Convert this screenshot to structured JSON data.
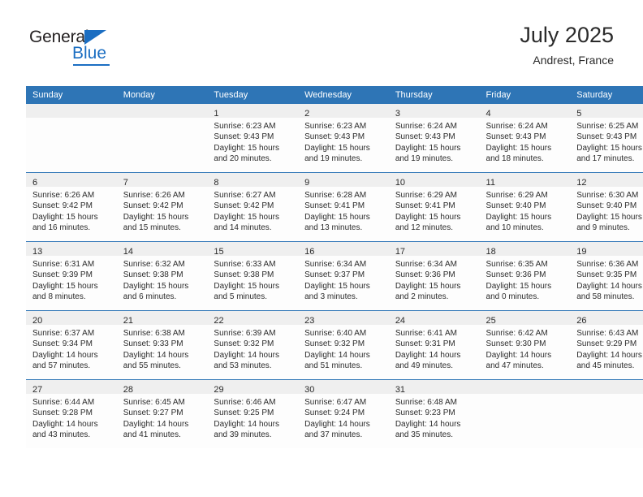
{
  "brand": {
    "name_top": "General",
    "name_bottom": "Blue",
    "accent_color": "#1b6ec2"
  },
  "header": {
    "title": "July 2025",
    "subtitle": "Andrest, France"
  },
  "theme": {
    "header_bar_color": "#2e75b6",
    "daynum_band_color": "#efefef",
    "separator_color": "#2e75b6",
    "text_color": "#2b2b2b"
  },
  "calendar": {
    "weekday_headers": [
      "Sunday",
      "Monday",
      "Tuesday",
      "Wednesday",
      "Thursday",
      "Friday",
      "Saturday"
    ],
    "weeks": [
      [
        {
          "day": "",
          "lines": []
        },
        {
          "day": "",
          "lines": []
        },
        {
          "day": "1",
          "lines": [
            "Sunrise: 6:23 AM",
            "Sunset: 9:43 PM",
            "Daylight: 15 hours",
            "and 20 minutes."
          ]
        },
        {
          "day": "2",
          "lines": [
            "Sunrise: 6:23 AM",
            "Sunset: 9:43 PM",
            "Daylight: 15 hours",
            "and 19 minutes."
          ]
        },
        {
          "day": "3",
          "lines": [
            "Sunrise: 6:24 AM",
            "Sunset: 9:43 PM",
            "Daylight: 15 hours",
            "and 19 minutes."
          ]
        },
        {
          "day": "4",
          "lines": [
            "Sunrise: 6:24 AM",
            "Sunset: 9:43 PM",
            "Daylight: 15 hours",
            "and 18 minutes."
          ]
        },
        {
          "day": "5",
          "lines": [
            "Sunrise: 6:25 AM",
            "Sunset: 9:43 PM",
            "Daylight: 15 hours",
            "and 17 minutes."
          ]
        }
      ],
      [
        {
          "day": "6",
          "lines": [
            "Sunrise: 6:26 AM",
            "Sunset: 9:42 PM",
            "Daylight: 15 hours",
            "and 16 minutes."
          ]
        },
        {
          "day": "7",
          "lines": [
            "Sunrise: 6:26 AM",
            "Sunset: 9:42 PM",
            "Daylight: 15 hours",
            "and 15 minutes."
          ]
        },
        {
          "day": "8",
          "lines": [
            "Sunrise: 6:27 AM",
            "Sunset: 9:42 PM",
            "Daylight: 15 hours",
            "and 14 minutes."
          ]
        },
        {
          "day": "9",
          "lines": [
            "Sunrise: 6:28 AM",
            "Sunset: 9:41 PM",
            "Daylight: 15 hours",
            "and 13 minutes."
          ]
        },
        {
          "day": "10",
          "lines": [
            "Sunrise: 6:29 AM",
            "Sunset: 9:41 PM",
            "Daylight: 15 hours",
            "and 12 minutes."
          ]
        },
        {
          "day": "11",
          "lines": [
            "Sunrise: 6:29 AM",
            "Sunset: 9:40 PM",
            "Daylight: 15 hours",
            "and 10 minutes."
          ]
        },
        {
          "day": "12",
          "lines": [
            "Sunrise: 6:30 AM",
            "Sunset: 9:40 PM",
            "Daylight: 15 hours",
            "and 9 minutes."
          ]
        }
      ],
      [
        {
          "day": "13",
          "lines": [
            "Sunrise: 6:31 AM",
            "Sunset: 9:39 PM",
            "Daylight: 15 hours",
            "and 8 minutes."
          ]
        },
        {
          "day": "14",
          "lines": [
            "Sunrise: 6:32 AM",
            "Sunset: 9:38 PM",
            "Daylight: 15 hours",
            "and 6 minutes."
          ]
        },
        {
          "day": "15",
          "lines": [
            "Sunrise: 6:33 AM",
            "Sunset: 9:38 PM",
            "Daylight: 15 hours",
            "and 5 minutes."
          ]
        },
        {
          "day": "16",
          "lines": [
            "Sunrise: 6:34 AM",
            "Sunset: 9:37 PM",
            "Daylight: 15 hours",
            "and 3 minutes."
          ]
        },
        {
          "day": "17",
          "lines": [
            "Sunrise: 6:34 AM",
            "Sunset: 9:36 PM",
            "Daylight: 15 hours",
            "and 2 minutes."
          ]
        },
        {
          "day": "18",
          "lines": [
            "Sunrise: 6:35 AM",
            "Sunset: 9:36 PM",
            "Daylight: 15 hours",
            "and 0 minutes."
          ]
        },
        {
          "day": "19",
          "lines": [
            "Sunrise: 6:36 AM",
            "Sunset: 9:35 PM",
            "Daylight: 14 hours",
            "and 58 minutes."
          ]
        }
      ],
      [
        {
          "day": "20",
          "lines": [
            "Sunrise: 6:37 AM",
            "Sunset: 9:34 PM",
            "Daylight: 14 hours",
            "and 57 minutes."
          ]
        },
        {
          "day": "21",
          "lines": [
            "Sunrise: 6:38 AM",
            "Sunset: 9:33 PM",
            "Daylight: 14 hours",
            "and 55 minutes."
          ]
        },
        {
          "day": "22",
          "lines": [
            "Sunrise: 6:39 AM",
            "Sunset: 9:32 PM",
            "Daylight: 14 hours",
            "and 53 minutes."
          ]
        },
        {
          "day": "23",
          "lines": [
            "Sunrise: 6:40 AM",
            "Sunset: 9:32 PM",
            "Daylight: 14 hours",
            "and 51 minutes."
          ]
        },
        {
          "day": "24",
          "lines": [
            "Sunrise: 6:41 AM",
            "Sunset: 9:31 PM",
            "Daylight: 14 hours",
            "and 49 minutes."
          ]
        },
        {
          "day": "25",
          "lines": [
            "Sunrise: 6:42 AM",
            "Sunset: 9:30 PM",
            "Daylight: 14 hours",
            "and 47 minutes."
          ]
        },
        {
          "day": "26",
          "lines": [
            "Sunrise: 6:43 AM",
            "Sunset: 9:29 PM",
            "Daylight: 14 hours",
            "and 45 minutes."
          ]
        }
      ],
      [
        {
          "day": "27",
          "lines": [
            "Sunrise: 6:44 AM",
            "Sunset: 9:28 PM",
            "Daylight: 14 hours",
            "and 43 minutes."
          ]
        },
        {
          "day": "28",
          "lines": [
            "Sunrise: 6:45 AM",
            "Sunset: 9:27 PM",
            "Daylight: 14 hours",
            "and 41 minutes."
          ]
        },
        {
          "day": "29",
          "lines": [
            "Sunrise: 6:46 AM",
            "Sunset: 9:25 PM",
            "Daylight: 14 hours",
            "and 39 minutes."
          ]
        },
        {
          "day": "30",
          "lines": [
            "Sunrise: 6:47 AM",
            "Sunset: 9:24 PM",
            "Daylight: 14 hours",
            "and 37 minutes."
          ]
        },
        {
          "day": "31",
          "lines": [
            "Sunrise: 6:48 AM",
            "Sunset: 9:23 PM",
            "Daylight: 14 hours",
            "and 35 minutes."
          ]
        },
        {
          "day": "",
          "lines": []
        },
        {
          "day": "",
          "lines": []
        }
      ]
    ]
  }
}
